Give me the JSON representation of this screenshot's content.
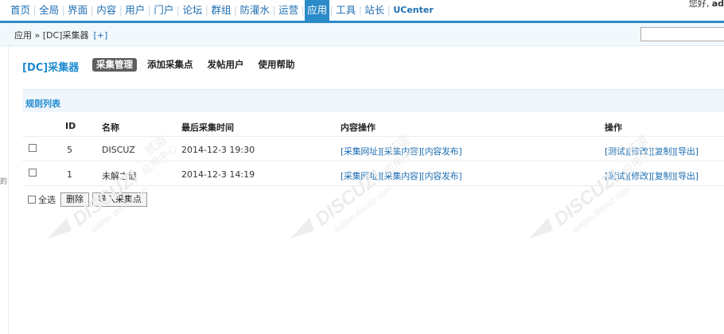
{
  "topnav": {
    "items": [
      {
        "label": "首页"
      },
      {
        "label": "全局"
      },
      {
        "label": "界面"
      },
      {
        "label": "内容"
      },
      {
        "label": "用户"
      },
      {
        "label": "门户"
      },
      {
        "label": "论坛"
      },
      {
        "label": "群组"
      },
      {
        "label": "防灌水"
      },
      {
        "label": "运营"
      },
      {
        "label": "应用",
        "active": true
      },
      {
        "label": "工具"
      },
      {
        "label": "站长"
      },
      {
        "label": "UCenter"
      }
    ],
    "greeting": "您好,",
    "username": "ad"
  },
  "breadcrumb": {
    "text": "应用 » [DC]采集器",
    "add": "[+]"
  },
  "search": {
    "value": ""
  },
  "sidebar_edge": {
    "glyph": "的"
  },
  "plugin": {
    "title": "[DC]采集器"
  },
  "subnav": [
    {
      "label": "采集管理",
      "current": true
    },
    {
      "label": "添加采集点"
    },
    {
      "label": "发帖用户"
    },
    {
      "label": "使用帮助"
    }
  ],
  "section": {
    "title": "规则列表"
  },
  "table": {
    "headers": {
      "id": "ID",
      "name": "名称",
      "time": "最后采集时间",
      "content_ops": "内容操作",
      "ops": "操作"
    },
    "rows": [
      {
        "id": "5",
        "name": "DISCUZ",
        "time": "2014-12-3 19:30",
        "content_links": [
          "[采集网址]",
          "[采集内容]",
          "[内容发布]"
        ],
        "op_links": [
          "[测试]",
          "[修改]",
          "[复制]",
          "[导出]"
        ]
      },
      {
        "id": "1",
        "name": "未解之谜",
        "time": "2014-12-3 14:19",
        "content_links": [
          "[采集网址]",
          "[采集内容]",
          "[内容发布]"
        ],
        "op_links": [
          "[测试]",
          "[修改]",
          "[复制]",
          "[导出]"
        ]
      }
    ]
  },
  "footer": {
    "select_all": "全选",
    "delete": "删除",
    "import": "导入采集点"
  },
  "watermark": {
    "brand": "DISCUZ!",
    "center": "应用中心",
    "sub": "addon.discuz.com",
    "mark": "贰道"
  }
}
